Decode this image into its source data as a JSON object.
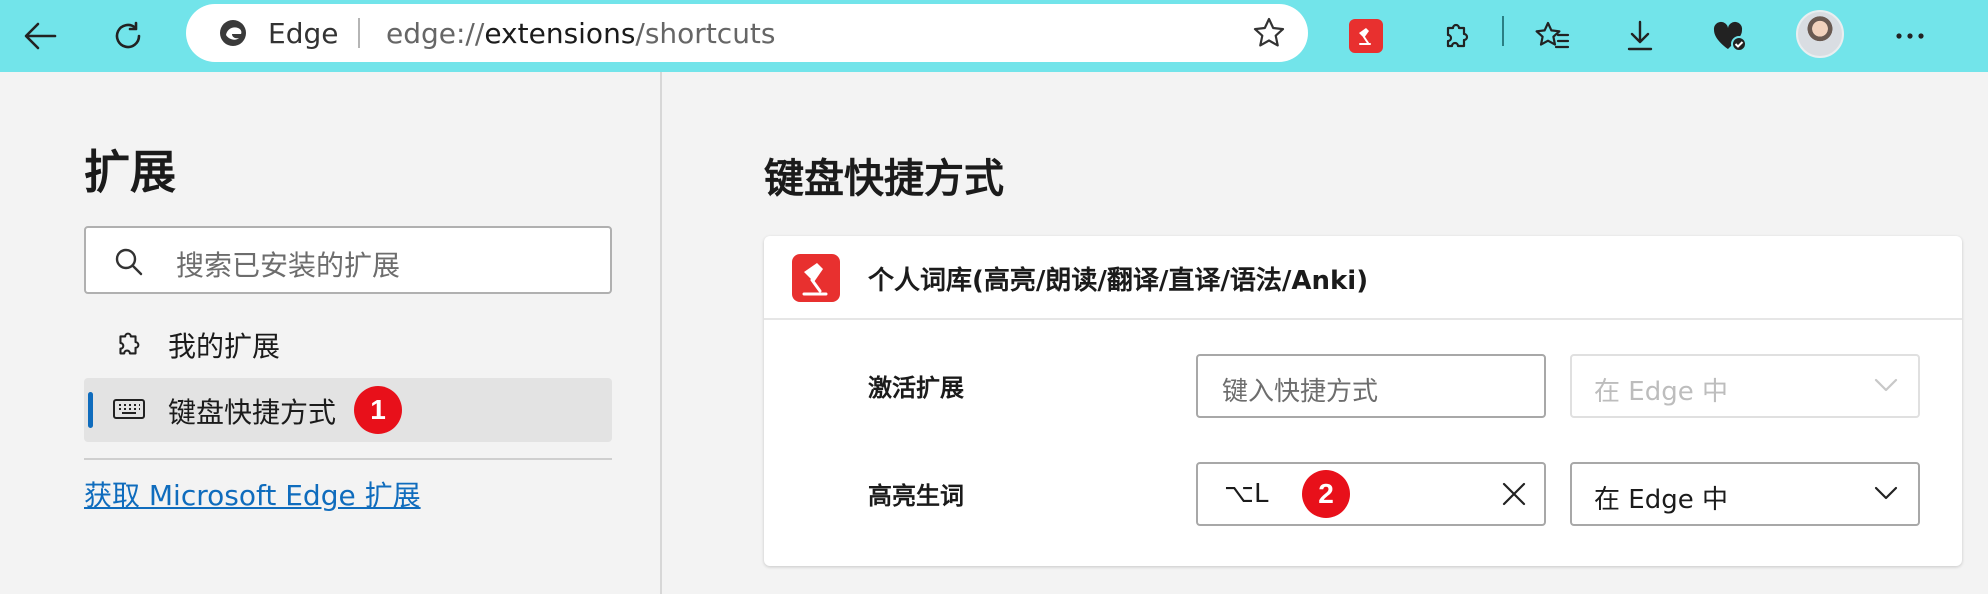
{
  "browser": {
    "brand": "Edge",
    "url_prefix": "edge://",
    "url_strong": "extensions",
    "url_suffix": "/shortcuts"
  },
  "sidebar": {
    "title": "扩展",
    "search_placeholder": "搜索已安装的扩展",
    "items": [
      {
        "label": "我的扩展",
        "icon": "puzzle-icon"
      },
      {
        "label": "键盘快捷方式",
        "icon": "keyboard-icon",
        "badge": "1"
      }
    ],
    "store_link": "获取 Microsoft Edge 扩展"
  },
  "main": {
    "title": "键盘快捷方式",
    "extension": {
      "name": "个人词库(高亮/朗读/翻译/直译/语法/Anki)",
      "color": "#e8302f",
      "rows": [
        {
          "label": "激活扩展",
          "input_placeholder": "键入快捷方式",
          "input_value": "",
          "scope": "在 Edge 中",
          "scope_disabled": true
        },
        {
          "label": "高亮生词",
          "input_placeholder": "",
          "input_value": "⌥L",
          "badge": "2",
          "scope": "在 Edge 中",
          "scope_disabled": false
        }
      ]
    }
  },
  "colors": {
    "toolbar": "#72e4ea",
    "accent": "#0f6cbd",
    "badge": "#e8101a"
  }
}
